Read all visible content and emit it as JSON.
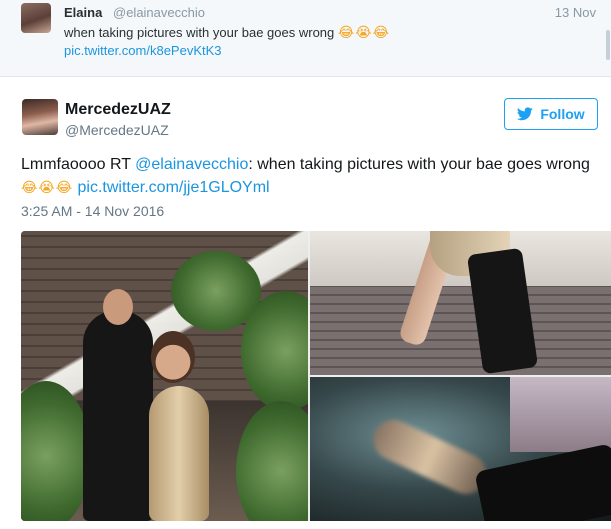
{
  "parent_tweet": {
    "name": "Elaina",
    "handle": "@elainavecchio",
    "date": "13 Nov",
    "text": "when taking pictures with your bae goes wrong",
    "emoji": "😂😭😂",
    "link": "pic.twitter.com/k8ePevKtK3"
  },
  "tweet": {
    "name": "MercedezUAZ",
    "handle": "@MercedezUAZ",
    "follow_label": "Follow",
    "text_prefix": "Lmmfaoooo RT ",
    "mention": "@elainavecchio",
    "text_body": ": when taking pictures with your bae goes wrong",
    "emoji": "😂😭😂",
    "link": "pic.twitter.com/jje1GLOYml",
    "timestamp": "3:25 AM - 14 Nov 2016"
  },
  "colors": {
    "accent": "#1da1f2",
    "link": "#1b95e0",
    "muted": "#657786",
    "parent_bg": "#f5f8fa"
  },
  "icons": [
    "bird-icon",
    "emoji-tears-of-joy-icon",
    "emoji-crying-icon"
  ]
}
